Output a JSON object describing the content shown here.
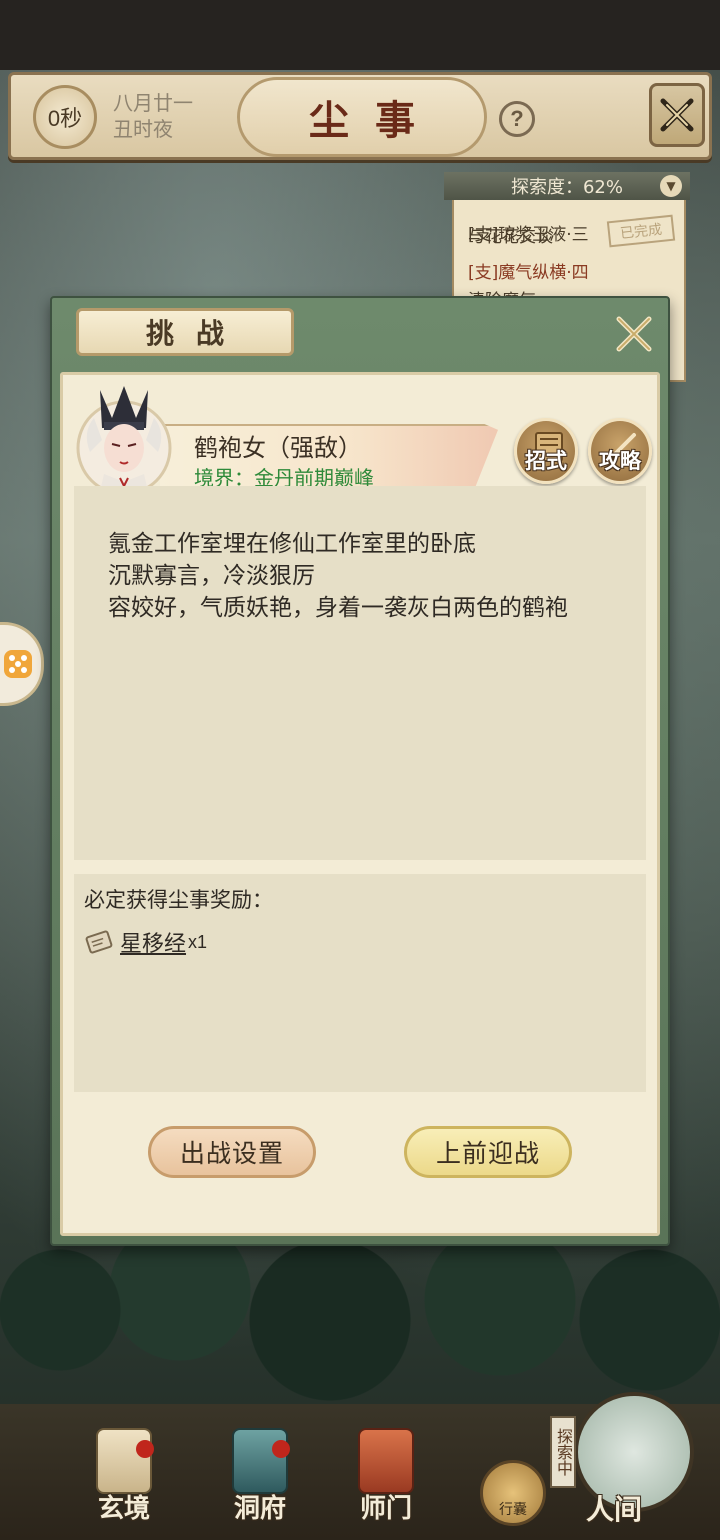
{
  "header": {
    "timer": "0秒",
    "date_line1": "八月廿一",
    "date_line2": "丑时夜",
    "title": "尘事",
    "help": "?"
  },
  "quest_panel": {
    "explore_label": "探索度：62%",
    "line1": "[支]琼浆玉液·三",
    "line2": "与花花交谈",
    "line3_tag": "[支]魔气纵横·四",
    "line4": "清除魔气",
    "done_stamp": "已完成"
  },
  "modal": {
    "tab_title": "挑战",
    "enemy": {
      "name": "鹤袍女（强敌）",
      "realm": "境界：金丹前期巅峰"
    },
    "skills_label": "招式",
    "guide_label": "攻略",
    "description": [
      "氪金工作室埋在修仙工作室里的卧底",
      "沉默寡言，冷淡狠厉",
      "容姣好，气质妖艳，身着一袭灰白两色的鹤袍"
    ],
    "reward_title": "必定获得尘事奖励：",
    "reward_item": {
      "name": "星移经",
      "qty": "x1"
    },
    "btn_settings": "出战设置",
    "btn_fight": "上前迎战"
  },
  "bottom_nav": {
    "items": [
      "玄境",
      "洞府",
      "师门"
    ],
    "bag_label": "行囊",
    "explore_tag": "探索中",
    "human_label": "人间"
  },
  "colors": {
    "modal_green": "#6e8a6c",
    "realm_green": "#2e8a3a",
    "title_red": "#6a2a18",
    "badge_red": "#c0261c"
  }
}
